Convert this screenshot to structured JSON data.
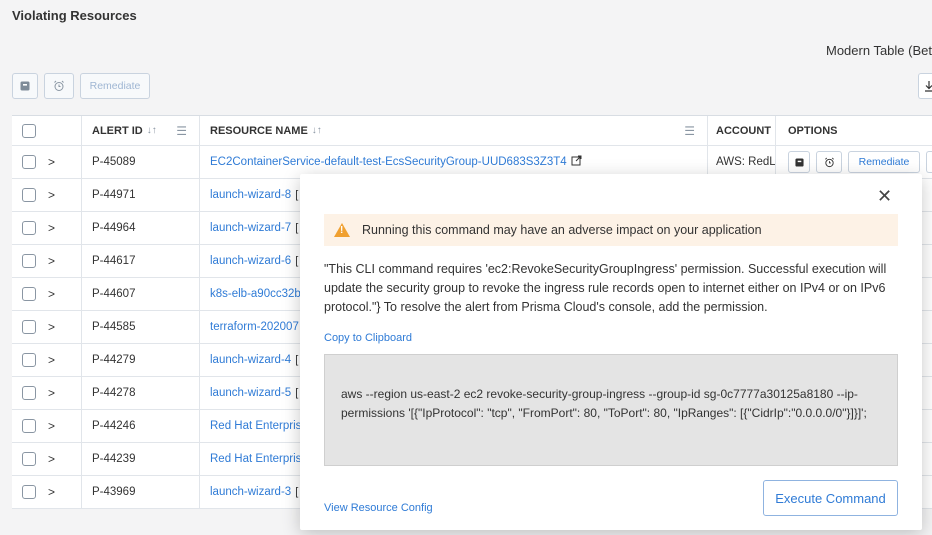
{
  "page": {
    "title": "Violating Resources",
    "modern_table_label": "Modern Table (Beta"
  },
  "toolbar": {
    "remediate_label": "Remediate"
  },
  "table": {
    "headers": {
      "alert_id": "ALERT ID",
      "resource_name": "RESOURCE NAME",
      "account": "ACCOUNT",
      "options": "OPTIONS"
    },
    "rows": [
      {
        "id": "P-45089",
        "resource": "EC2ContainerService-default-test-EcsSecurityGroup-UUD683S3Z3T4",
        "account": "AWS: RedLo"
      },
      {
        "id": "P-44971",
        "resource": "launch-wizard-8"
      },
      {
        "id": "P-44964",
        "resource": "launch-wizard-7"
      },
      {
        "id": "P-44617",
        "resource": "launch-wizard-6"
      },
      {
        "id": "P-44607",
        "resource": "k8s-elb-a90cc32b"
      },
      {
        "id": "P-44585",
        "resource": "terraform-202007"
      },
      {
        "id": "P-44279",
        "resource": "launch-wizard-4"
      },
      {
        "id": "P-44278",
        "resource": "launch-wizard-5"
      },
      {
        "id": "P-44246",
        "resource": "Red Hat Enterpris"
      },
      {
        "id": "P-44239",
        "resource": "Red Hat Enterpris"
      },
      {
        "id": "P-43969",
        "resource": "launch-wizard-3"
      }
    ],
    "row_remediate_label": "Remediate"
  },
  "modal": {
    "warning": "Running this command may have an adverse impact on your application",
    "description": "\"This CLI command requires 'ec2:RevokeSecurityGroupIngress' permission. Successful execution will update the security group to revoke the ingress rule records open to internet either on IPv4 or on IPv6 protocol.\"} To resolve the alert from Prisma Cloud's console, add the permission.",
    "copy_label": "Copy to Clipboard",
    "command": "aws --region us-east-2 ec2 revoke-security-group-ingress --group-id sg-0c7777a30125a8180 --ip-permissions '[{\"IpProtocol\": \"tcp\", \"FromPort\": 80, \"ToPort\": 80, \"IpRanges\": [{\"CidrIp\":\"0.0.0.0/0\"}]}]';",
    "view_config_label": "View Resource Config",
    "execute_label": "Execute Command"
  },
  "colors": {
    "link": "#2f7bd6",
    "warning_bg": "#fdf2e6",
    "warning_icon": "#f0a030",
    "code_bg": "#e4e4e4"
  }
}
